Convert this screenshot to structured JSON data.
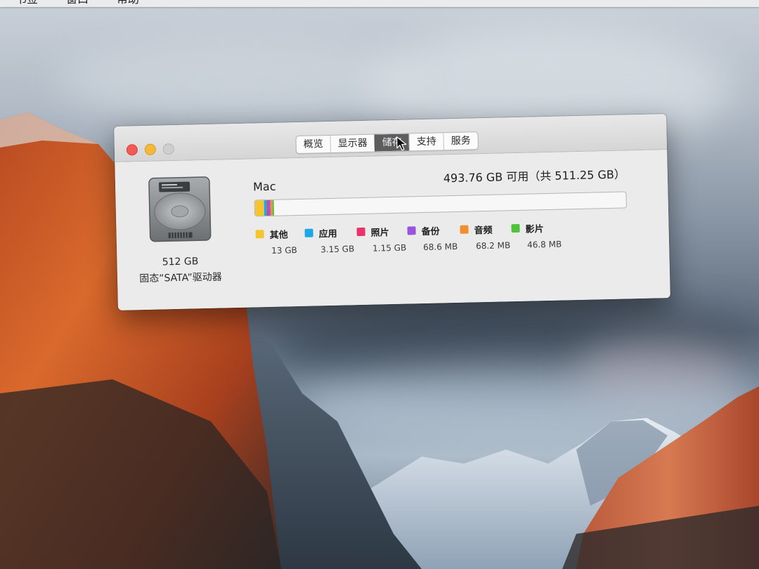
{
  "menubar": {
    "items": [
      "书签",
      "窗口",
      "帮助"
    ]
  },
  "window": {
    "tabs": [
      {
        "label": "概览",
        "active": false
      },
      {
        "label": "显示器",
        "active": false
      },
      {
        "label": "储存",
        "active": true
      },
      {
        "label": "支持",
        "active": false
      },
      {
        "label": "服务",
        "active": false
      }
    ],
    "disk": {
      "size": "512 GB",
      "type": "固态“SATA”驱动器",
      "icon": "hard-drive-icon"
    },
    "volume": {
      "name": "Mac",
      "free_text": "493.76 GB 可用（共 511.25 GB）"
    },
    "usage": {
      "categories": [
        {
          "label": "其他",
          "size": "13 GB",
          "color": "#f4c531",
          "fraction": 0.0254
        },
        {
          "label": "应用",
          "size": "3.15 GB",
          "color": "#1ea7e8",
          "fraction": 0.0062
        },
        {
          "label": "照片",
          "size": "1.15 GB",
          "color": "#e8336d",
          "fraction": 0.0023
        },
        {
          "label": "备份",
          "size": "68.6 MB",
          "color": "#9a55dd",
          "fraction": 0.0013
        },
        {
          "label": "音频",
          "size": "68.2 MB",
          "color": "#f18f2e",
          "fraction": 0.0013
        },
        {
          "label": "影片",
          "size": "46.8 MB",
          "color": "#52c23e",
          "fraction": 0.001
        }
      ]
    }
  },
  "colors": {
    "active_tab": "#5d5d5f",
    "window_bg": "#ebebeb"
  }
}
